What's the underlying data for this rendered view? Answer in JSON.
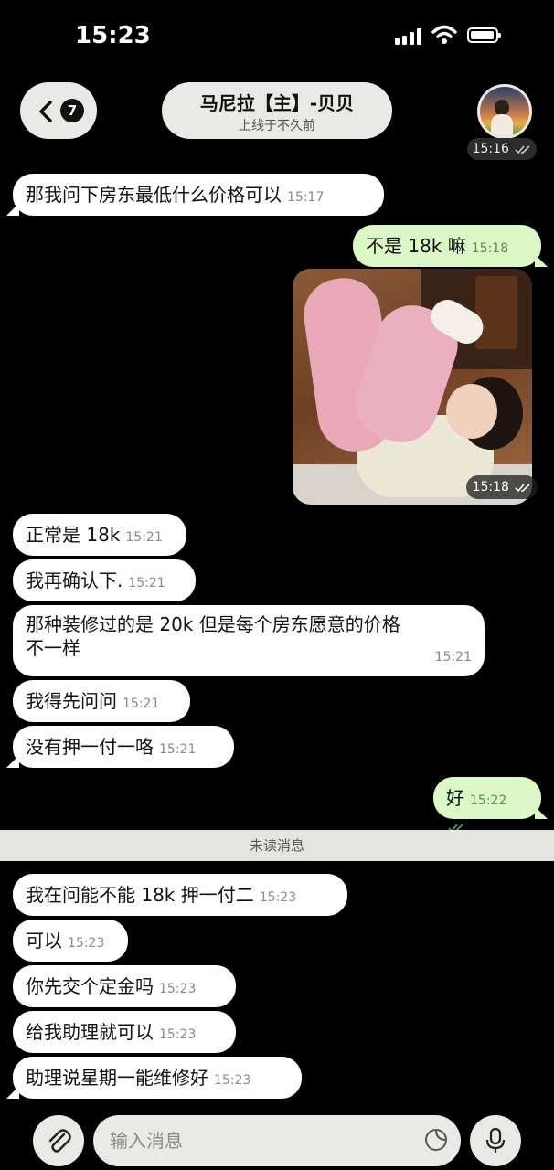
{
  "status_bar": {
    "time": "15:23",
    "icons": [
      "signal-icon",
      "wifi-icon",
      "battery-icon"
    ]
  },
  "header": {
    "back_badge": "7",
    "title": "马尼拉【主】-贝贝",
    "subtitle": "上线于不久前",
    "avatar_time": "15:16"
  },
  "messages": [
    {
      "text": "那我问下房东最低什么价格可以",
      "time": "15:17",
      "side": "in"
    },
    {
      "text": "不是 18k 嘛",
      "time": "15:18",
      "side": "out"
    },
    {
      "type": "photo",
      "time": "15:18",
      "side": "out"
    },
    {
      "text": "正常是 18k",
      "time": "15:21",
      "side": "in"
    },
    {
      "text": "我再确认下.",
      "time": "15:21",
      "side": "in"
    },
    {
      "text_line1": "那种装修过的是 20k  但是每个房东愿意的价格",
      "text_line2": "不一样",
      "time": "15:21",
      "side": "in"
    },
    {
      "text": "我得先问问",
      "time": "15:21",
      "side": "in"
    },
    {
      "text": "没有押一付一咯",
      "time": "15:21",
      "side": "in"
    },
    {
      "text": "好",
      "time": "15:22",
      "side": "out"
    },
    {
      "text": "我在问能不能 18k 押一付二",
      "time": "15:23",
      "side": "in"
    },
    {
      "text": "可以",
      "time": "15:23",
      "side": "in"
    },
    {
      "text": "你先交个定金吗",
      "time": "15:23",
      "side": "in"
    },
    {
      "text": "给我助理就可以",
      "time": "15:23",
      "side": "in"
    },
    {
      "text": "助理说星期一能维修好",
      "time": "15:23",
      "side": "in"
    }
  ],
  "unread_divider": "未读消息",
  "input": {
    "placeholder": "输入消息",
    "icons": [
      "paperclip-icon",
      "sticker-icon",
      "microphone-icon"
    ]
  },
  "colors": {
    "background": "#000000",
    "incoming_bubble": "#ffffff",
    "outgoing_bubble": "#dcf8c6",
    "read_check": "#4caf50"
  }
}
